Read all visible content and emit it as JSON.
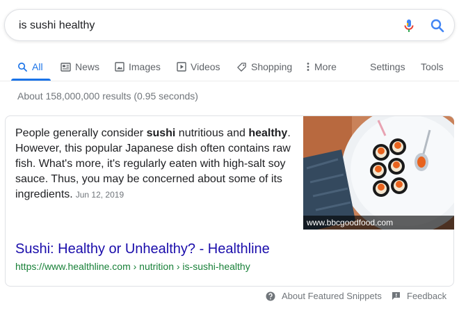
{
  "search": {
    "query": "is sushi healthy"
  },
  "icons": {
    "mic": "microphone-icon",
    "search": "search-icon"
  },
  "tabs": [
    {
      "label": "All",
      "icon": "search-icon",
      "active": true
    },
    {
      "label": "News",
      "icon": "news-icon"
    },
    {
      "label": "Images",
      "icon": "image-icon"
    },
    {
      "label": "Videos",
      "icon": "play-icon"
    },
    {
      "label": "Shopping",
      "icon": "tag-icon"
    },
    {
      "label": "More",
      "icon": "more-vertical-icon"
    }
  ],
  "tools": {
    "settings": "Settings",
    "tools": "Tools"
  },
  "stats": "About 158,000,000 results (0.95 seconds)",
  "snippet": {
    "part1": "People generally consider ",
    "bold1": "sushi",
    "part2": " nutritious and ",
    "bold2": "healthy",
    "part3": ". However, this popular Japanese dish often contains raw fish. What's more, it's regularly eaten with high-salt soy sauce. Thus, you may be concerned about some of its ingredients.",
    "date": "Jun 12, 2019",
    "image_caption": "www.bbcgoodfood.com",
    "title": "Sushi: Healthy or Unhealthy? - Healthline",
    "url": "https://www.healthline.com › nutrition › is-sushi-healthy"
  },
  "footer": {
    "about": "About Featured Snippets",
    "feedback": "Feedback"
  },
  "colors": {
    "accent": "#1a73e8",
    "link": "#1a0dab",
    "url": "#188038",
    "muted": "#70757a"
  }
}
